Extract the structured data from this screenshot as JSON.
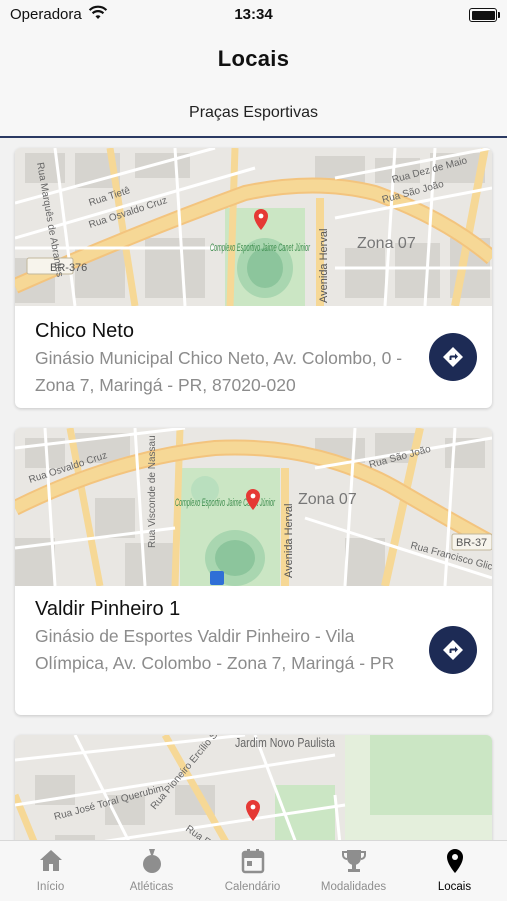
{
  "status_bar": {
    "carrier": "Operadora",
    "time": "13:34"
  },
  "header": {
    "title": "Locais",
    "segment": "Praças Esportivas"
  },
  "locations": [
    {
      "name": "Chico Neto",
      "address": "Ginásio Municipal Chico Neto, Av. Colombo, 0 - Zona 7, Maringá - PR, 87020-020",
      "map_labels": {
        "complex": "Complexo Esportivo Jaime Canet Júnior",
        "zone": "Zona 07",
        "highway": "BR-376",
        "street_a": "Rua Tietê",
        "street_b": "Rua Osvaldo Cruz",
        "street_c": "Rua Dez de Maio",
        "street_d": "Rua São João",
        "street_e": "Avenida Herval",
        "street_f": "Rua Marquês de Abrantes"
      }
    },
    {
      "name": "Valdir Pinheiro 1",
      "address": "Ginásio de Esportes Valdir Pinheiro - Vila Olímpica, Av. Colombo - Zona 7, Maringá - PR",
      "map_labels": {
        "complex": "Complexo Esportivo Jaime Canet Júnior",
        "zone": "Zona 07",
        "highway": "BR-37",
        "street_a": "Rua Osvaldo Cruz",
        "street_b": "Rua Visconde de Nassau",
        "street_c": "Rua São João",
        "street_d": "Avenida Herval",
        "street_e": "Rua Francisco Glice"
      }
    },
    {
      "name": "",
      "address": "",
      "map_labels": {
        "area": "Jardim Novo Paulista",
        "street_a": "Rua José Toral Querubim",
        "street_b": "Rua Pioneiro Ercílio Silva",
        "street_c": "Rua Francisco Dias de"
      }
    }
  ],
  "tab_bar": {
    "tabs": [
      {
        "label": "Início",
        "icon": "home-icon"
      },
      {
        "label": "Atléticas",
        "icon": "medal-icon"
      },
      {
        "label": "Calendário",
        "icon": "calendar-icon"
      },
      {
        "label": "Modalidades",
        "icon": "trophy-icon"
      },
      {
        "label": "Locais",
        "icon": "location-pin-icon",
        "active": true
      }
    ]
  },
  "colors": {
    "accent": "#1d2b55",
    "map_road": "#f6d896",
    "map_park": "#cbe6c4",
    "pin": "#e53935"
  }
}
